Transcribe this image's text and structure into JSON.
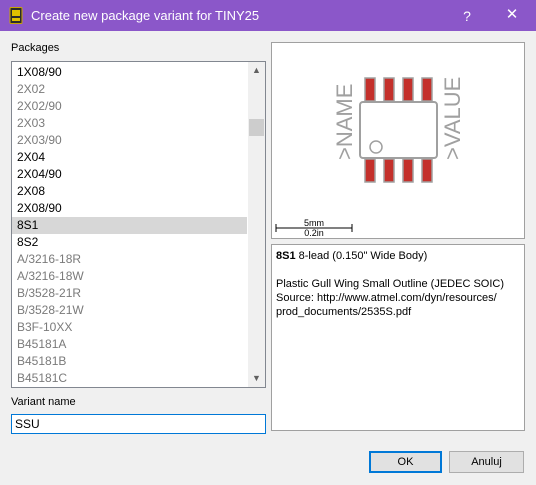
{
  "window": {
    "title": "Create new package variant for TINY25",
    "help_glyph": "?",
    "close_glyph": "✕"
  },
  "packages": {
    "label": "Packages",
    "items": [
      {
        "label": "1X08/90",
        "dim": false
      },
      {
        "label": "2X02",
        "dim": true
      },
      {
        "label": "2X02/90",
        "dim": true
      },
      {
        "label": "2X03",
        "dim": true
      },
      {
        "label": "2X03/90",
        "dim": true
      },
      {
        "label": "2X04",
        "dim": false
      },
      {
        "label": "2X04/90",
        "dim": false
      },
      {
        "label": "2X08",
        "dim": false
      },
      {
        "label": "2X08/90",
        "dim": false
      },
      {
        "label": "8S1",
        "dim": false,
        "selected": true
      },
      {
        "label": "8S2",
        "dim": false
      },
      {
        "label": "A/3216-18R",
        "dim": true
      },
      {
        "label": "A/3216-18W",
        "dim": true
      },
      {
        "label": "B/3528-21R",
        "dim": true
      },
      {
        "label": "B/3528-21W",
        "dim": true
      },
      {
        "label": "B3F-10XX",
        "dim": true
      },
      {
        "label": "B45181A",
        "dim": true
      },
      {
        "label": "B45181B",
        "dim": true
      },
      {
        "label": "B45181C",
        "dim": true
      }
    ]
  },
  "preview": {
    "name_label": ">NAME",
    "value_label": ">VALUE",
    "scale_mm": "5mm",
    "scale_in": "0.2in",
    "colors": {
      "outline": "#a0a0a0",
      "pad": "#c4302b"
    }
  },
  "description": {
    "name": "8S1",
    "subtitle": "8-lead (0.150\" Wide Body)",
    "line1": "Plastic Gull Wing Small Outline (JEDEC SOIC)",
    "line2": "Source: http://www.atmel.com/dyn/resources/",
    "line3": "prod_documents/2535S.pdf"
  },
  "variant": {
    "label": "Variant name",
    "value": "SSU"
  },
  "buttons": {
    "ok": "OK",
    "cancel": "Anuluj"
  }
}
